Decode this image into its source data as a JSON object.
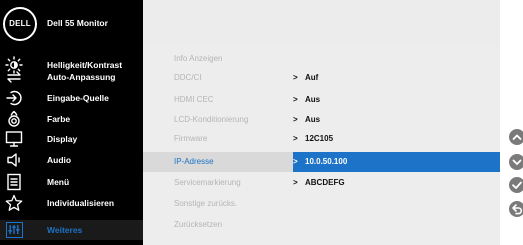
{
  "header": {
    "logo_text": "DELL",
    "monitor_name": "Dell 55 Monitor"
  },
  "nav": {
    "items": [
      {
        "label": "Helligkeit/Kontrast",
        "icon": "brightness-icon"
      },
      {
        "label": "Auto-Anpassung",
        "icon": "auto-adjust-icon"
      },
      {
        "label": "Eingabe-Quelle",
        "icon": "input-source-icon"
      },
      {
        "label": "Farbe",
        "icon": "color-icon"
      },
      {
        "label": "Display",
        "icon": "display-icon"
      },
      {
        "label": "Audio",
        "icon": "audio-icon"
      },
      {
        "label": "Menü",
        "icon": "menu-icon"
      },
      {
        "label": "Individualisieren",
        "icon": "personalize-icon"
      },
      {
        "label": "Weiteres",
        "icon": "others-icon",
        "active": true
      }
    ]
  },
  "content": {
    "rows": [
      {
        "label": "Info Anzeigen",
        "value": ""
      },
      {
        "label": "DDC/CI",
        "value": "Auf"
      },
      {
        "label": "HDMI CEC",
        "value": "Aus"
      },
      {
        "label": "LCD-Konditionierung",
        "value": "Aus"
      },
      {
        "label": "Firmware",
        "value": "12C105"
      },
      {
        "label": "IP-Adresse",
        "value": "10.0.50.100",
        "selected": true
      },
      {
        "label": "Servicemarkierung",
        "value": "ABCDEFG"
      },
      {
        "label": "Sonstige zurücks.",
        "value": ""
      },
      {
        "label": "Zurücksetzen",
        "value": ""
      }
    ],
    "arrow": ">"
  },
  "controls": [
    {
      "icon": "chevron-up-icon"
    },
    {
      "icon": "chevron-down-icon"
    },
    {
      "icon": "checkmark-icon"
    },
    {
      "icon": "back-icon"
    }
  ],
  "colors": {
    "accent": "#1d73c7",
    "osd_background": "#000000",
    "panel_background": "#ededed",
    "control_button": "#7a7a7a"
  }
}
